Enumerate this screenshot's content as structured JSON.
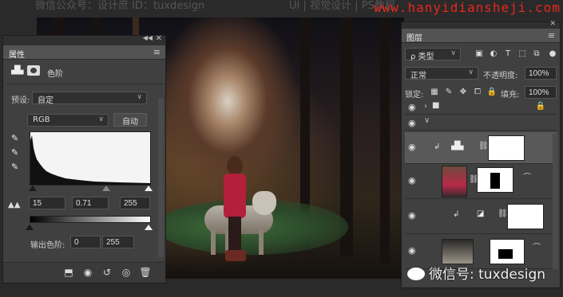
{
  "watermark_top": {
    "left": "微信公众号：设计庶  ID：tuxdesign",
    "middle": "UI | 视觉设计 | PS教程",
    "url": "www.hanyidiansheji.com"
  },
  "properties": {
    "tab_title": "属性",
    "adjustment_label": "色阶",
    "preset_label": "预设:",
    "preset_value": "自定",
    "channel_value": "RGB",
    "auto_label": "自动",
    "input_black": "15",
    "input_gamma": "0.71",
    "input_white": "255",
    "output_label": "输出色阶:",
    "output_black": "0",
    "output_white": "255",
    "icons": [
      "clip-to-layer-icon",
      "view-previous-icon",
      "reset-icon",
      "visibility-icon",
      "delete-icon"
    ]
  },
  "layers": {
    "tab_title": "图层",
    "filter_label": "ρ 类型",
    "blend_mode": "正常",
    "opacity_label": "不透明度:",
    "opacity_value": "100%",
    "lock_label": "锁定:",
    "fill_label": "填充:",
    "fill_value": "100%"
  },
  "watermark_bottom": "微信号: tuxdesign"
}
